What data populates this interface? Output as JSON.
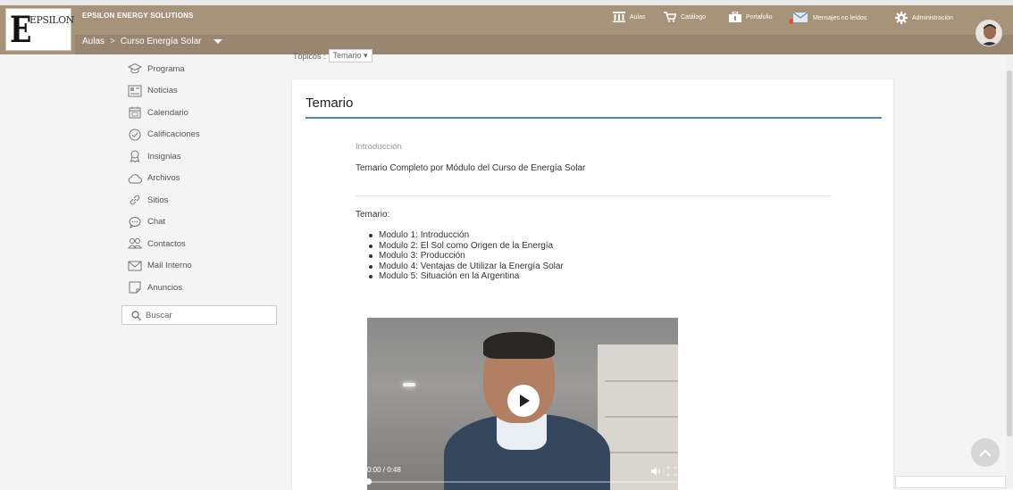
{
  "header": {
    "company": "EPSILON ENERGY SOLUTIONS",
    "logo_text": "EPSILON",
    "logo_letter": "E",
    "breadcrumb": [
      "Aulas",
      ">",
      "Curso Energía Solar"
    ]
  },
  "topnav": [
    {
      "label": "Aulas",
      "icon": "columns-icon"
    },
    {
      "label": "Catálogo",
      "icon": "cart-icon"
    },
    {
      "label": "Portafolio",
      "icon": "briefcase-icon"
    },
    {
      "label": "Mensajes no leídos",
      "icon": "envelope-icon"
    },
    {
      "label": "Administración",
      "icon": "gear-icon"
    }
  ],
  "topics": {
    "label": "Tópicos :",
    "selected": "Temario"
  },
  "sidebar": {
    "items": [
      {
        "label": "Programa",
        "icon": "graduation-cap-icon"
      },
      {
        "label": "Noticias",
        "icon": "newspaper-icon"
      },
      {
        "label": "Calendario",
        "icon": "calendar-icon"
      },
      {
        "label": "Calificaciones",
        "icon": "check-circle-icon"
      },
      {
        "label": "Insignias",
        "icon": "badge-icon"
      },
      {
        "label": "Archivos",
        "icon": "cloud-icon"
      },
      {
        "label": "Sitios",
        "icon": "link-icon"
      },
      {
        "label": "Chat",
        "icon": "chat-bubble-icon"
      },
      {
        "label": "Contactos",
        "icon": "contacts-icon"
      },
      {
        "label": "Mail Interno",
        "icon": "mail-icon"
      },
      {
        "label": "Anuncios",
        "icon": "announcement-icon"
      }
    ],
    "search_placeholder": "Buscar"
  },
  "main": {
    "title": "Temario",
    "intro_label": "Introducción",
    "intro_text": "Temario Completo por Módulo del Curso de Energía Solar",
    "temario_label": "Temario:",
    "modules": [
      "Modulo 1: Introducción",
      "Modulo 2: El Sol como Origen de la Energía",
      "Modulo 3: Producción",
      "Modulo 4: Ventajas de Utilizar la Energía Solar",
      "Modulo 5: Situación en la Argentina"
    ],
    "video": {
      "time": "0:00 / 0:48",
      "progress": 0
    }
  },
  "colors": {
    "header": "#a6937a",
    "accent": "#4b8bb5"
  }
}
